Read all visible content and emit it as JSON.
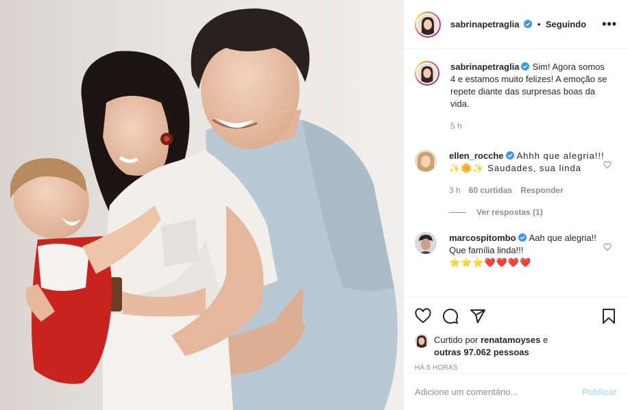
{
  "post": {
    "author": "sabrinapetraglia",
    "follow_status": "Seguindo",
    "more_label": "•••",
    "dot": "•"
  },
  "caption": {
    "username": "sabrinapetraglia",
    "text": "Sim! Agora somos 4 e estamos muito felizes! A emoção se repete diante das surpresas boas da vida.",
    "time": "5 h"
  },
  "comments": [
    {
      "username": "ellen_rocche",
      "text": "Ahhh que alegria!!! ✨🌼✨ Saudades, sua linda",
      "time": "3 h",
      "likes": "60 curtidas",
      "reply_label": "Responder",
      "view_replies": "Ver respostas (1)"
    },
    {
      "username": "marcospitombo",
      "text": "Aah que alegria!! Que família linda!!!",
      "emojis": "⭐⭐⭐❤️❤️❤️❤️"
    }
  ],
  "likes_block": {
    "prefix": "Curtido por",
    "user": "renatamoyses",
    "connector": "e",
    "others": "outras 97.062 pessoas",
    "timestamp": "HÁ 5 HORAS"
  },
  "composer": {
    "placeholder": "Adicione um comentário...",
    "publish_label": "Publicar"
  },
  "colors": {
    "text": "#262626",
    "muted": "#8e8e8e",
    "verified": "#3897f0",
    "publish_disabled": "#b2dffc",
    "border": "#efefef"
  },
  "icons": [
    "more-icon",
    "verified-icon",
    "heart-icon",
    "comment-icon",
    "share-icon",
    "save-icon"
  ]
}
